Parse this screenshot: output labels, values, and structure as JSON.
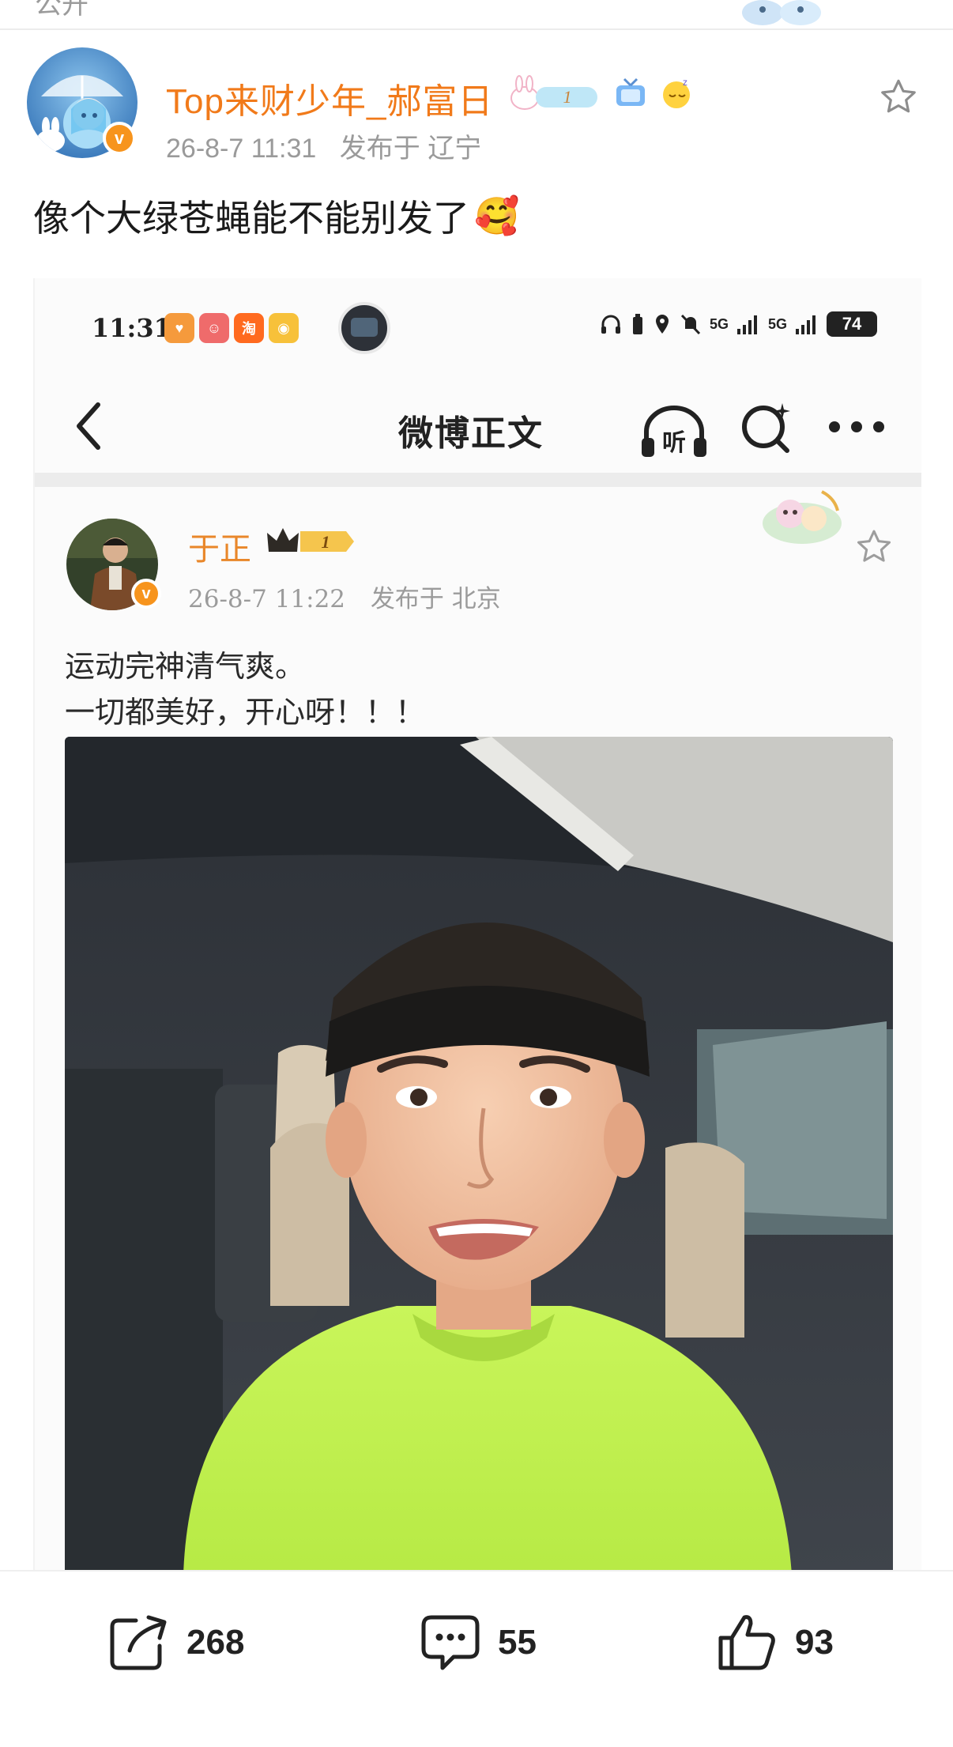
{
  "top_strip": {
    "cut_text": "公开"
  },
  "post": {
    "username": "Top来财少年_郝富日",
    "level_badge": "1",
    "timestamp": "26-8-7 11:31",
    "location": "发布于 辽宁",
    "text": "像个大绿苍蝇能不能别发了",
    "text_emoji": "🥰"
  },
  "embedded_screenshot": {
    "status_bar": {
      "time": "11:31",
      "signal_1": "5G",
      "signal_2": "5G",
      "battery": "74"
    },
    "nav": {
      "title": "微博正文",
      "listen_label": "听"
    },
    "inner_post": {
      "username": "于正",
      "crown_level": "1",
      "timestamp": "26-8-7 11:22",
      "location": "发布于 北京",
      "line1": "运动完神清气爽。",
      "line2": "一切都美好，开心呀！！！"
    }
  },
  "actions": {
    "repost_count": "268",
    "comment_count": "55",
    "like_count": "93"
  },
  "colors": {
    "username_orange": "#f17a1a",
    "verified_badge": "#f7941d",
    "meta_gray": "#9a9a9a"
  }
}
